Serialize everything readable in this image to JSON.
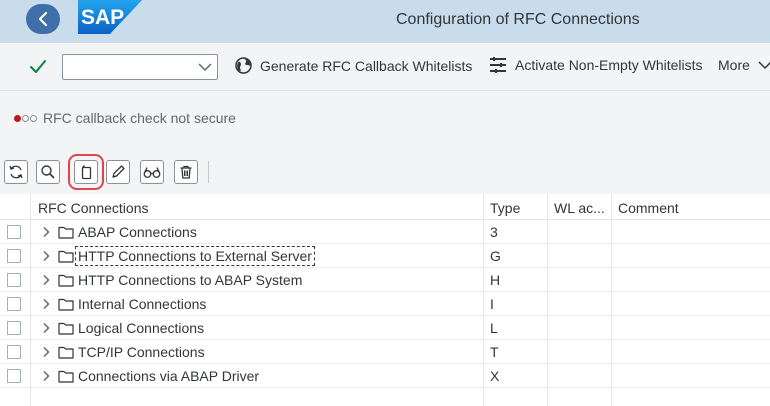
{
  "shell": {
    "title": "Configuration of RFC Connections",
    "logo_text": "SAP"
  },
  "toolbar": {
    "command_field": {
      "value": "",
      "placeholder": ""
    },
    "generate_label": "Generate RFC Callback Whitelists",
    "activate_label": "Activate Non-Empty Whitelists",
    "more_label": "More"
  },
  "status": {
    "text": "RFC callback check not secure"
  },
  "icon_toolbar": [
    {
      "name": "refresh-icon"
    },
    {
      "name": "search-icon"
    },
    {
      "name": "copy-icon",
      "highlighted": true
    },
    {
      "name": "edit-icon"
    },
    {
      "name": "display-icon"
    },
    {
      "name": "delete-icon"
    }
  ],
  "table": {
    "columns": {
      "name": "RFC Connections",
      "type": "Type",
      "wl": "WL ac...",
      "comment": "Comment"
    },
    "rows": [
      {
        "label": "ABAP Connections",
        "type": "3"
      },
      {
        "label": "HTTP Connections to External Server",
        "type": "G",
        "focused": true
      },
      {
        "label": "HTTP Connections to ABAP System",
        "type": "H"
      },
      {
        "label": "Internal Connections",
        "type": "I"
      },
      {
        "label": "Logical Connections",
        "type": "L"
      },
      {
        "label": "TCP/IP Connections",
        "type": "T"
      },
      {
        "label": "Connections via ABAP Driver",
        "type": "X"
      }
    ]
  },
  "colors": {
    "shell_bg": "#c8dcec",
    "back_button": "#3f6fa8",
    "sap_blue": "#1a73d1",
    "accept_green": "#107e3e",
    "highlight_red": "#e0454a",
    "status_red": "#c1161c"
  }
}
